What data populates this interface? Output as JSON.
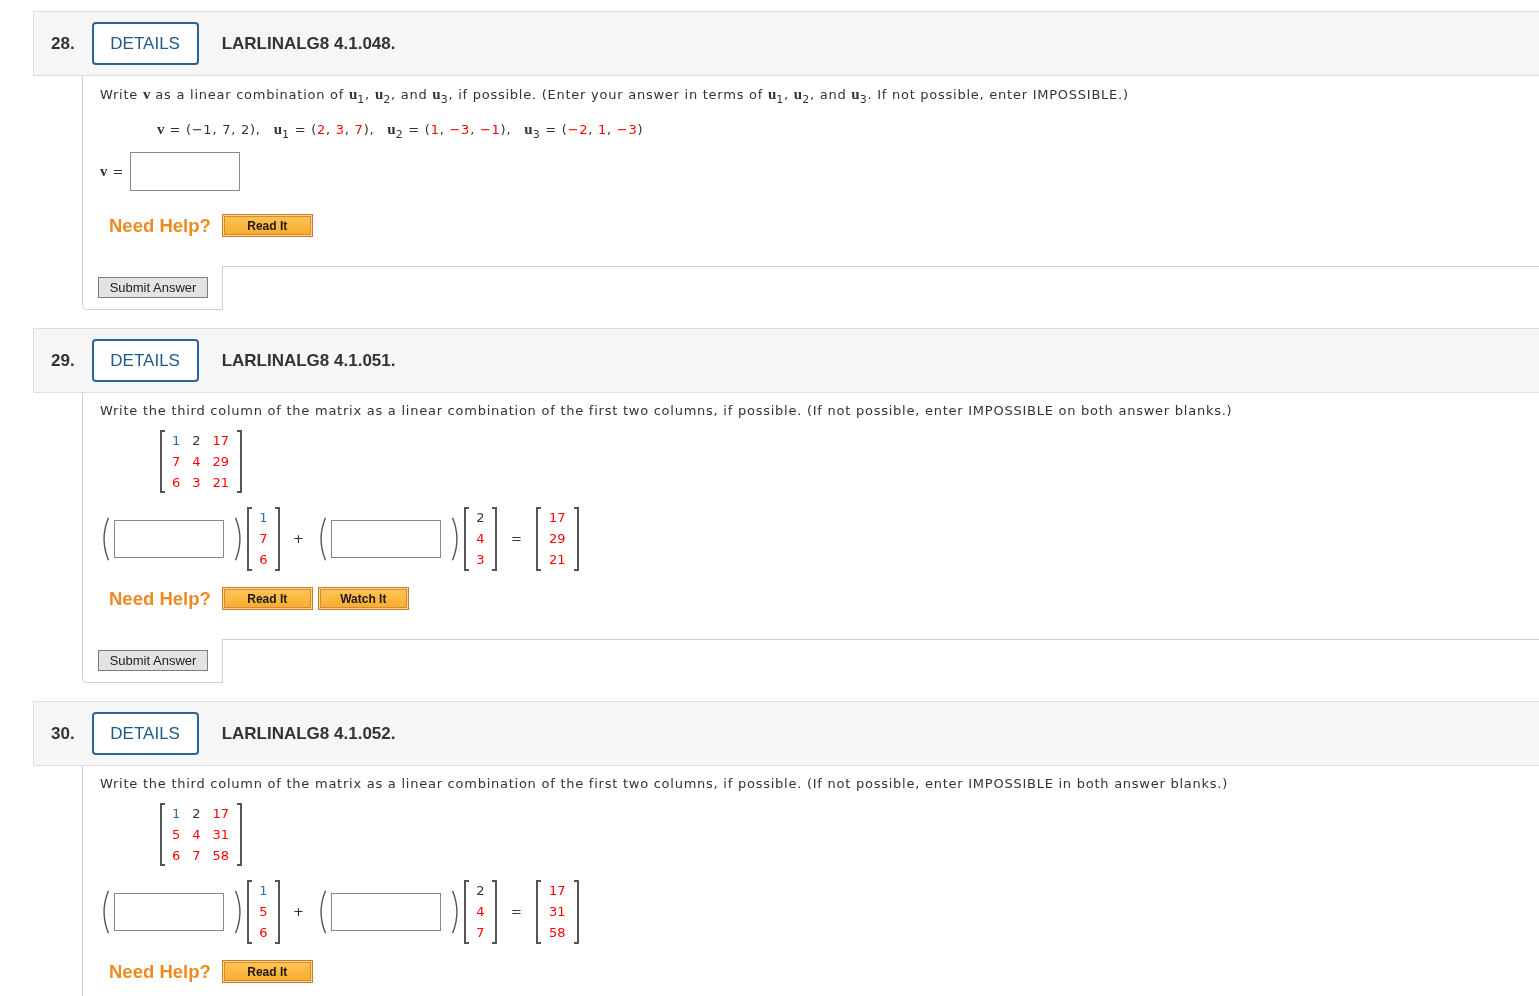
{
  "questions": [
    {
      "number": "28.",
      "details_button": "DETAILS",
      "code": "LARLINALG8 4.1.048.",
      "kind": "vector_combination",
      "prompt": "Write **v** as a linear combination of **u**$_{1}$, **u**$_{2}$, and **u**$_{3}$, if possible. (Enter your answer in terms of **u**$_{1}$, **u**$_{2}$, and **u**$_{3}$. If not possible, enter IMPOSSIBLE.)",
      "vectors": [
        {
          "parts": [
            {
              "text": "**v** = (−1, 7, 2),"
            }
          ]
        },
        {
          "parts": [
            {
              "text": "**u**$_{1}$ = ("
            },
            {
              "text": "2",
              "color": "#ff0000"
            },
            {
              "text": ", "
            },
            {
              "text": "3",
              "color": "#ff0000"
            },
            {
              "text": ", "
            },
            {
              "text": "7",
              "color": "#ff0000"
            },
            {
              "text": "),"
            }
          ]
        },
        {
          "parts": [
            {
              "text": "**u**$_{2}$ = ("
            },
            {
              "text": "1",
              "color": "#ff0000"
            },
            {
              "text": ", "
            },
            {
              "text": "−3",
              "color": "#ff0000"
            },
            {
              "text": ", "
            },
            {
              "text": "−1",
              "color": "#ff0000"
            },
            {
              "text": "),"
            }
          ]
        },
        {
          "parts": [
            {
              "text": "**u**$_{3}$ = ("
            },
            {
              "text": "−2",
              "color": "#ff0000"
            },
            {
              "text": ", "
            },
            {
              "text": "1",
              "color": "#ff0000"
            },
            {
              "text": ", "
            },
            {
              "text": "−3",
              "color": "#ff0000"
            },
            {
              "text": ")"
            }
          ]
        }
      ],
      "answer_label": "**v** =",
      "help_label": "Need Help?",
      "help_buttons": [
        "Read It"
      ],
      "submit_button": "Submit Answer"
    },
    {
      "number": "29.",
      "details_button": "DETAILS",
      "code": "LARLINALG8 4.1.051.",
      "kind": "matrix_columns",
      "prompt": "Write the third column of the matrix as a linear combination of the first two columns, if possible. (If not possible, enter IMPOSSIBLE on both answer blanks.)",
      "matrix": {
        "rows": [
          [
            {
              "value": "1",
              "color": "#2e6da4"
            },
            {
              "value": "2",
              "color": "#333333"
            },
            {
              "value": "17",
              "color": "#ff0000"
            }
          ],
          [
            {
              "value": "7",
              "color": "#ff0000"
            },
            {
              "value": "4",
              "color": "#ff0000"
            },
            {
              "value": "29",
              "color": "#ff0000"
            }
          ],
          [
            {
              "value": "6",
              "color": "#ff0000"
            },
            {
              "value": "3",
              "color": "#ff0000"
            },
            {
              "value": "21",
              "color": "#ff0000"
            }
          ]
        ]
      },
      "combination": {
        "terms": [
          {
            "column": [
              {
                "value": "1",
                "color": "#2e6da4"
              },
              {
                "value": "7",
                "color": "#ff0000"
              },
              {
                "value": "6",
                "color": "#ff0000"
              }
            ]
          },
          {
            "column": [
              {
                "value": "2",
                "color": "#333333"
              },
              {
                "value": "4",
                "color": "#ff0000"
              },
              {
                "value": "3",
                "color": "#ff0000"
              }
            ]
          }
        ],
        "plus": "+",
        "equals": "=",
        "result": [
          {
            "value": "17",
            "color": "#ff0000"
          },
          {
            "value": "29",
            "color": "#ff0000"
          },
          {
            "value": "21",
            "color": "#ff0000"
          }
        ]
      },
      "help_label": "Need Help?",
      "help_buttons": [
        "Read It",
        "Watch It"
      ],
      "submit_button": "Submit Answer"
    },
    {
      "number": "30.",
      "details_button": "DETAILS",
      "code": "LARLINALG8 4.1.052.",
      "kind": "matrix_columns",
      "prompt": "Write the third column of the matrix as a linear combination of the first two columns, if possible. (If not possible, enter IMPOSSIBLE in both answer blanks.)",
      "matrix": {
        "rows": [
          [
            {
              "value": "1",
              "color": "#2e6da4"
            },
            {
              "value": "2",
              "color": "#333333"
            },
            {
              "value": "17",
              "color": "#ff0000"
            }
          ],
          [
            {
              "value": "5",
              "color": "#ff0000"
            },
            {
              "value": "4",
              "color": "#ff0000"
            },
            {
              "value": "31",
              "color": "#ff0000"
            }
          ],
          [
            {
              "value": "6",
              "color": "#ff0000"
            },
            {
              "value": "7",
              "color": "#ff0000"
            },
            {
              "value": "58",
              "color": "#ff0000"
            }
          ]
        ]
      },
      "combination": {
        "terms": [
          {
            "column": [
              {
                "value": "1",
                "color": "#2e6da4"
              },
              {
                "value": "5",
                "color": "#ff0000"
              },
              {
                "value": "6",
                "color": "#ff0000"
              }
            ]
          },
          {
            "column": [
              {
                "value": "2",
                "color": "#333333"
              },
              {
                "value": "4",
                "color": "#ff0000"
              },
              {
                "value": "7",
                "color": "#ff0000"
              }
            ]
          }
        ],
        "plus": "+",
        "equals": "=",
        "result": [
          {
            "value": "17",
            "color": "#ff0000"
          },
          {
            "value": "31",
            "color": "#ff0000"
          },
          {
            "value": "58",
            "color": "#ff0000"
          }
        ]
      },
      "help_label": "Need Help?",
      "help_buttons": [
        "Read It"
      ]
    }
  ]
}
